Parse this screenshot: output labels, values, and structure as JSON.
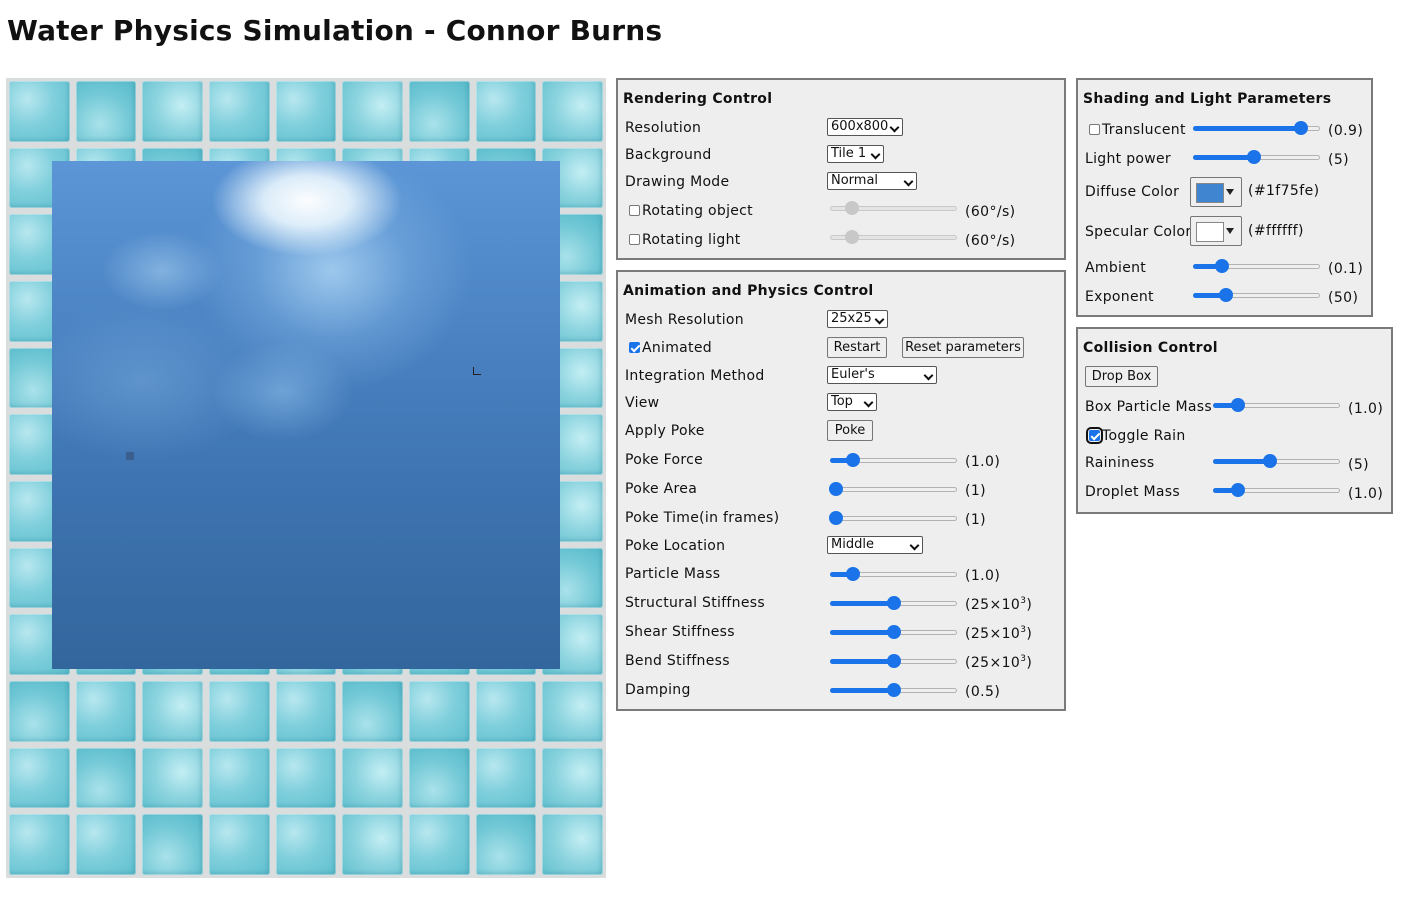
{
  "page_title": "Water Physics Simulation - Connor Burns",
  "colors": {
    "water": "#3d73b0",
    "tile": "#7fcfdc",
    "accent": "#1a73e8",
    "panel_bg": "#eeeeee"
  },
  "rendering": {
    "title": "Rendering Control",
    "resolution_label": "Resolution",
    "resolution_value": "600x800",
    "background_label": "Background",
    "background_value": "Tile 1",
    "drawing_mode_label": "Drawing Mode",
    "drawing_mode_value": "Normal",
    "rotating_object_label": "Rotating object",
    "rotating_object_checked": false,
    "rotating_object_value": "(60°/s)",
    "rotating_light_label": "Rotating light",
    "rotating_light_checked": false,
    "rotating_light_value": "(60°/s)"
  },
  "animation": {
    "title": "Animation and Physics Control",
    "mesh_label": "Mesh Resolution",
    "mesh_value": "25x25",
    "animated_label": "Animated",
    "animated_checked": true,
    "restart_label": "Restart",
    "reset_label": "Reset parameters",
    "integration_label": "Integration Method",
    "integration_value": "Euler's",
    "view_label": "View",
    "view_value": "Top",
    "apply_poke_label": "Apply Poke",
    "poke_button": "Poke",
    "poke_force_label": "Poke Force",
    "poke_force_value": "(1.0)",
    "poke_area_label": "Poke Area",
    "poke_area_value": "(1)",
    "poke_time_label": "Poke Time(in frames)",
    "poke_time_value": "(1)",
    "poke_location_label": "Poke Location",
    "poke_location_value": "Middle",
    "particle_mass_label": "Particle Mass",
    "particle_mass_value": "(1.0)",
    "structural_label": "Structural Stiffness",
    "structural_value": "(25×10",
    "shear_label": "Shear Stiffness",
    "shear_value": "(25×10",
    "bend_label": "Bend Stiffness",
    "bend_value": "(25×10",
    "exp_sup": "3",
    "close_paren": ")",
    "damping_label": "Damping",
    "damping_value": "(0.5)"
  },
  "shading": {
    "title": "Shading and Light Parameters",
    "translucent_label": "Translucent",
    "translucent_checked": false,
    "translucent_value": "(0.9)",
    "light_power_label": "Light power",
    "light_power_value": "(5)",
    "diffuse_label": "Diffuse Color",
    "diffuse_value": "(#1f75fe)",
    "diffuse_swatch": "#3f85cf",
    "specular_label": "Specular Color",
    "specular_value": "(#ffffff)",
    "specular_swatch": "#ffffff",
    "ambient_label": "Ambient",
    "ambient_value": "(0.1)",
    "exponent_label": "Exponent",
    "exponent_value": "(50)"
  },
  "collision": {
    "title": "Collision Control",
    "drop_box_label": "Drop Box",
    "box_mass_label": "Box Particle Mass",
    "box_mass_value": "(1.0)",
    "toggle_rain_label": "Toggle Rain",
    "toggle_rain_checked": true,
    "raininess_label": "Raininess",
    "raininess_value": "(5)",
    "droplet_mass_label": "Droplet Mass",
    "droplet_mass_value": "(1.0)"
  },
  "slider_levels": {
    "rotating_object": 0.17,
    "rotating_light": 0.17,
    "poke_force": 0.18,
    "poke_area": 0.05,
    "poke_time": 0.05,
    "particle_mass": 0.18,
    "structural": 0.5,
    "shear": 0.5,
    "bend": 0.5,
    "damping": 0.5,
    "translucent": 0.85,
    "light_power": 0.48,
    "ambient": 0.23,
    "exponent": 0.26,
    "box_mass": 0.2,
    "raininess": 0.45,
    "droplet_mass": 0.2
  }
}
